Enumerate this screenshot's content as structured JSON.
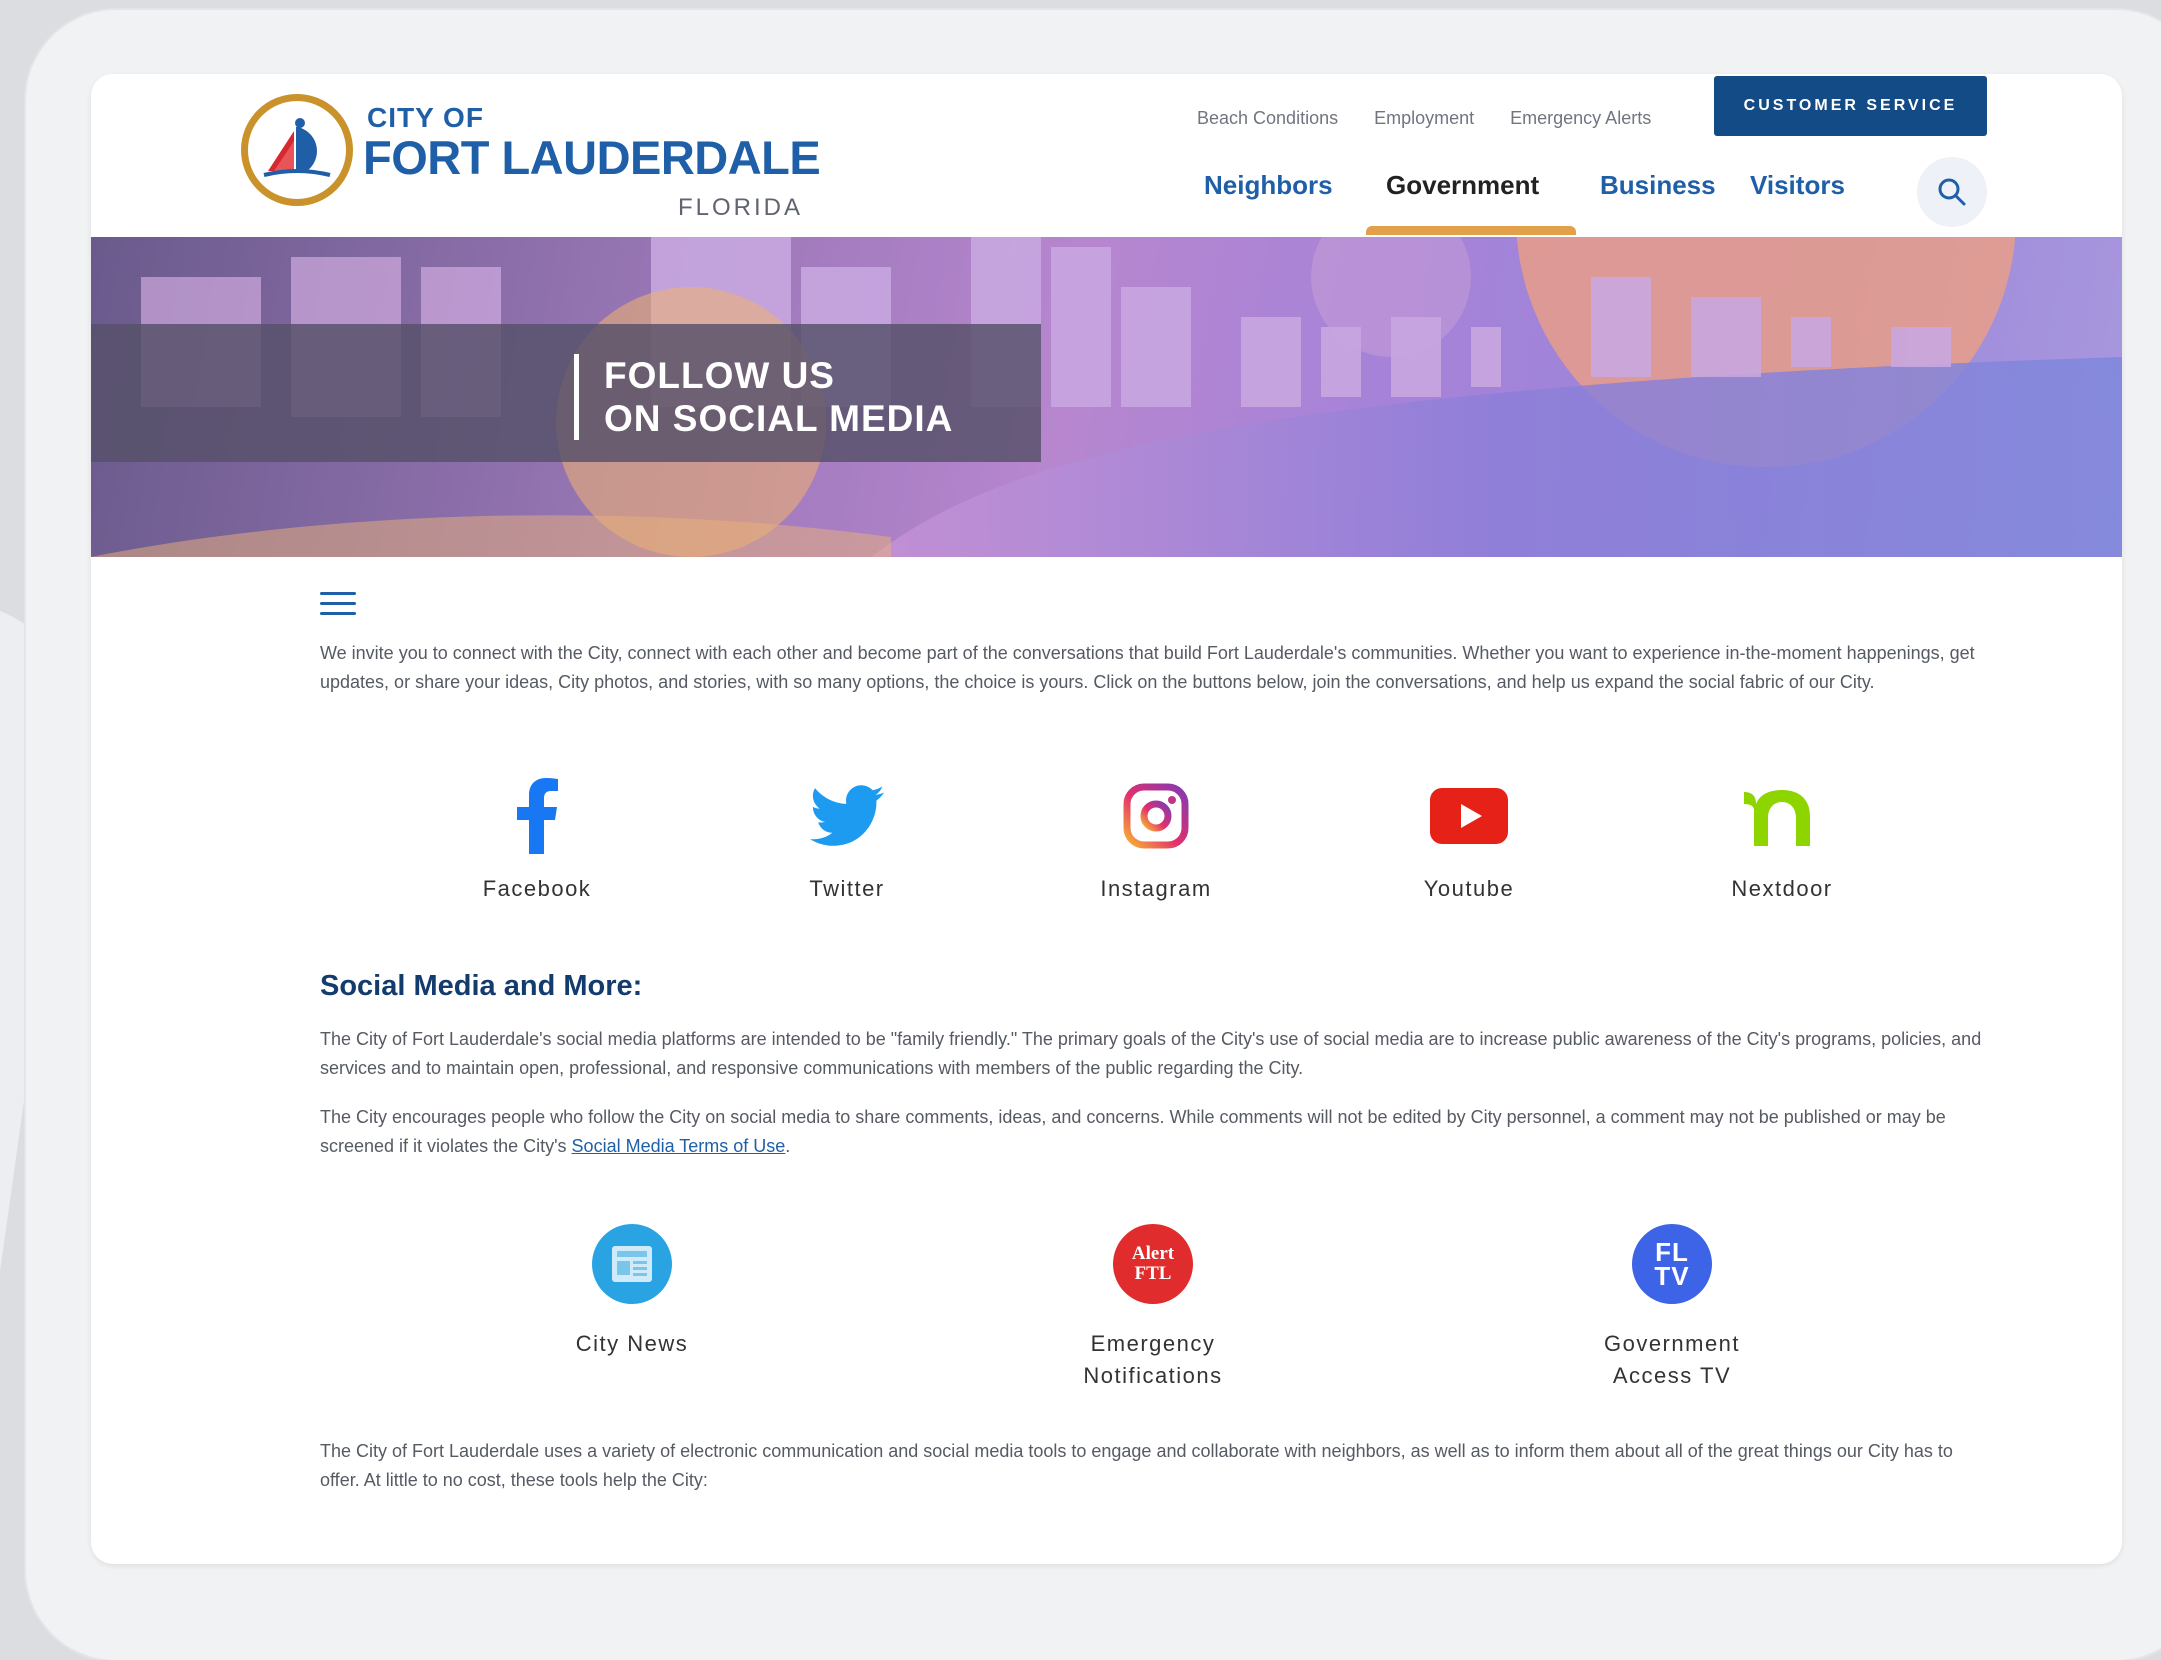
{
  "logo": {
    "city_of": "CITY OF",
    "name": "FORT LAUDERDALE",
    "state": "FLORIDA"
  },
  "utility_links": [
    "Beach Conditions",
    "Employment",
    "Emergency Alerts"
  ],
  "customer_service_label": "CUSTOMER SERVICE",
  "main_nav": [
    "Neighbors",
    "Government",
    "Business",
    "Visitors"
  ],
  "active_nav": "Government",
  "hero": {
    "line1": "FOLLOW US",
    "line2": "ON SOCIAL MEDIA"
  },
  "intro_text": "We invite you to connect with the City, connect with each other and become part of the conversations that build Fort Lauderdale's communities. Whether you want to experience in-the-moment happenings, get updates, or share your ideas, City photos, and stories, with so many options, the choice is yours. Click on the buttons below, join the conversations, and help us expand the social fabric of our City.",
  "social_links": [
    {
      "label": "Facebook",
      "icon": "facebook-icon",
      "color": "#1877f2"
    },
    {
      "label": "Twitter",
      "icon": "twitter-icon",
      "color": "#1d9bf0"
    },
    {
      "label": "Instagram",
      "icon": "instagram-icon",
      "color": "#d62976"
    },
    {
      "label": "Youtube",
      "icon": "youtube-icon",
      "color": "#e62117"
    },
    {
      "label": "Nextdoor",
      "icon": "nextdoor-icon",
      "color": "#8ed500"
    }
  ],
  "section_title": "Social Media and More:",
  "para1": "The City of Fort Lauderdale's social media platforms are intended to be \"family friendly.\" The primary goals of the City's use of social media are to increase public awareness of the City's programs, policies, and services and to maintain open, professional, and responsive communications with members of the public regarding the City.",
  "para2_before": "The City encourages people who follow the City on social media to share comments, ideas, and concerns. While comments will not be edited by City personnel, a comment may not be published or may be screened if it violates the City's ",
  "para2_link": "Social Media Terms of Use",
  "para2_after": ".",
  "tools": [
    {
      "line1": "City News",
      "line2": "",
      "icon": "city-news-icon",
      "badge": "NEWS",
      "color": "#2aa3e2"
    },
    {
      "line1": "Emergency",
      "line2": "Notifications",
      "icon": "alert-ftl-icon",
      "badge": "Alert FTL",
      "color": "#e02c2c"
    },
    {
      "line1": "Government",
      "line2": "Access TV",
      "icon": "fltv-icon",
      "badge": "FL TV",
      "color": "#3d63e6"
    }
  ],
  "closing_text": "The City of Fort Lauderdale uses a variety of electronic communication and social media tools to engage and collaborate with neighbors, as well as to inform them about all of the great things our City has to offer. At little to no cost, these tools help the City:"
}
